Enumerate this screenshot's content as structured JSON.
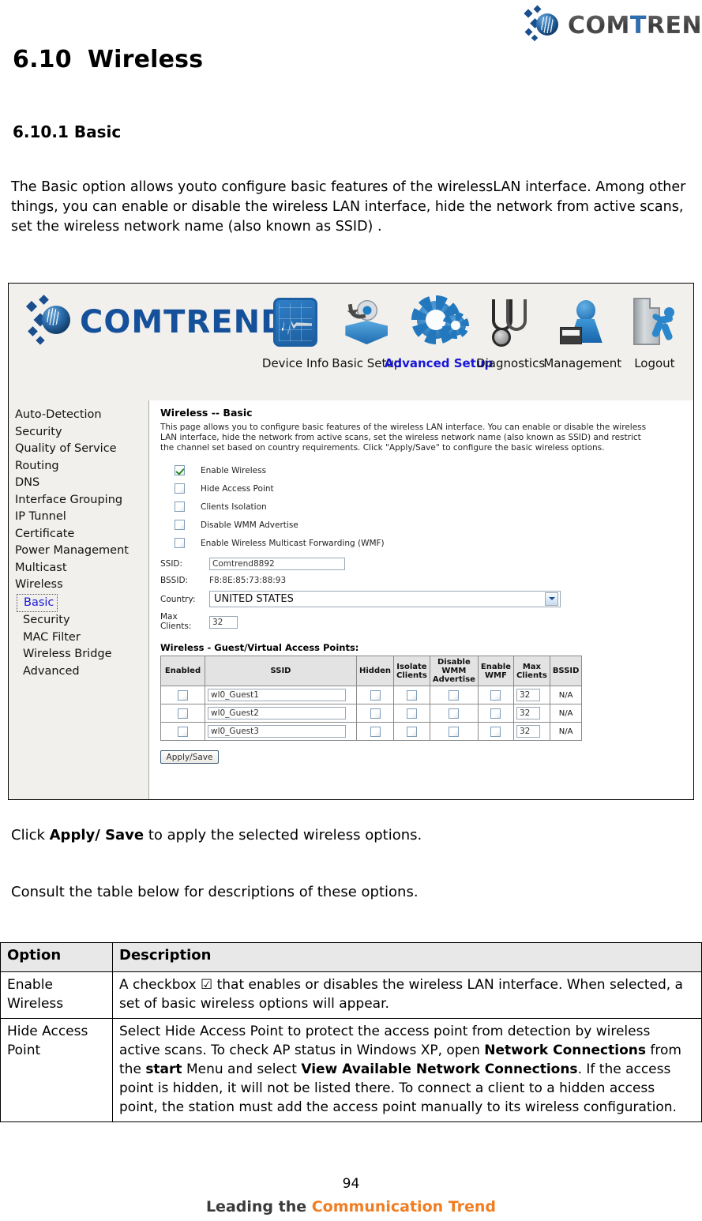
{
  "page": {
    "brand": "COMTREND",
    "brand_t": "T",
    "section_number": "6.10",
    "section_title": "Wireless",
    "subsection_title": "6.10.1 Basic",
    "intro_paragraph": "The Basic option allows youto configure basic features of the wirelessLAN interface. Among other things, you can enable or disable the wireless LAN interface, hide the network from active scans, set the wireless network name (also known as SSID) .",
    "click_apply_prefix": "Click ",
    "click_apply_bold": "Apply/ Save",
    "click_apply_suffix": " to apply the selected wireless options.",
    "consult_paragraph": "Consult the table below for descriptions of these options.",
    "page_number": "94",
    "footer_lead": "Leading the ",
    "footer_orange1": "Communication ",
    "footer_orange2": "Trend"
  },
  "router_ui": {
    "brand": "COMTREND",
    "nav": [
      {
        "label": "Device Info",
        "icon": "device-info-icon",
        "active": false
      },
      {
        "label": "Basic Setup",
        "icon": "basic-setup-icon",
        "active": false
      },
      {
        "label": "Advanced Setup",
        "icon": "advanced-setup-gear-icon",
        "active": true
      },
      {
        "label": "Diagnostics",
        "icon": "stethoscope-icon",
        "active": false
      },
      {
        "label": "Management",
        "icon": "management-user-icon",
        "active": false
      },
      {
        "label": "Logout",
        "icon": "logout-door-icon",
        "active": false
      }
    ],
    "sidebar": [
      {
        "label": "Auto-Detection",
        "sub": false,
        "current": false
      },
      {
        "label": "Security",
        "sub": false,
        "current": false
      },
      {
        "label": "Quality of Service",
        "sub": false,
        "current": false
      },
      {
        "label": "Routing",
        "sub": false,
        "current": false
      },
      {
        "label": "DNS",
        "sub": false,
        "current": false
      },
      {
        "label": "Interface Grouping",
        "sub": false,
        "current": false
      },
      {
        "label": "IP Tunnel",
        "sub": false,
        "current": false
      },
      {
        "label": "Certificate",
        "sub": false,
        "current": false
      },
      {
        "label": "Power Management",
        "sub": false,
        "current": false
      },
      {
        "label": "Multicast",
        "sub": false,
        "current": false
      },
      {
        "label": "Wireless",
        "sub": false,
        "current": false
      },
      {
        "label": "Basic",
        "sub": true,
        "current": true
      },
      {
        "label": "Security",
        "sub": true,
        "current": false
      },
      {
        "label": "MAC Filter",
        "sub": true,
        "current": false
      },
      {
        "label": "Wireless Bridge",
        "sub": true,
        "current": false
      },
      {
        "label": "Advanced",
        "sub": true,
        "current": false
      }
    ],
    "content": {
      "title": "Wireless -- Basic",
      "description": "This page allows you to configure basic features of the wireless LAN interface. You can enable or disable the wireless LAN interface, hide the network from active scans, set the wireless network name (also known as SSID) and restrict the channel set based on country requirements. Click \"Apply/Save\" to configure the basic wireless options.",
      "checkboxes": [
        {
          "label": "Enable Wireless",
          "checked": true
        },
        {
          "label": "Hide Access Point",
          "checked": false
        },
        {
          "label": "Clients Isolation",
          "checked": false
        },
        {
          "label": "Disable WMM Advertise",
          "checked": false
        },
        {
          "label": "Enable Wireless Multicast Forwarding (WMF)",
          "checked": false
        }
      ],
      "fields": {
        "ssid_label": "SSID:",
        "ssid_value": "Comtrend8892",
        "bssid_label": "BSSID:",
        "bssid_value": "F8:8E:85:73:88:93",
        "country_label": "Country:",
        "country_value": "UNITED STATES",
        "max_clients_label_line1": "Max",
        "max_clients_label_line2": "Clients:",
        "max_clients_value": "32"
      },
      "guest_table": {
        "title": "Wireless - Guest/Virtual Access Points:",
        "headers": [
          "Enabled",
          "SSID",
          "Hidden",
          "Isolate Clients",
          "Disable WMM Advertise",
          "Enable WMF",
          "Max Clients",
          "BSSID"
        ],
        "rows": [
          {
            "enabled": false,
            "ssid": "wl0_Guest1",
            "hidden": false,
            "isolate": false,
            "disable_wmm": false,
            "enable_wmf": false,
            "max_clients": "32",
            "bssid": "N/A"
          },
          {
            "enabled": false,
            "ssid": "wl0_Guest2",
            "hidden": false,
            "isolate": false,
            "disable_wmm": false,
            "enable_wmf": false,
            "max_clients": "32",
            "bssid": "N/A"
          },
          {
            "enabled": false,
            "ssid": "wl0_Guest3",
            "hidden": false,
            "isolate": false,
            "disable_wmm": false,
            "enable_wmf": false,
            "max_clients": "32",
            "bssid": "N/A"
          }
        ]
      },
      "apply_button": "Apply/Save"
    }
  },
  "options_table": {
    "header_option": "Option",
    "header_description": "Description",
    "rows": [
      {
        "option": "Enable Wireless",
        "description": "A checkbox ☑ that enables or disables the wireless LAN interface. When selected, a set of basic wireless options will appear."
      },
      {
        "option": "Hide Access Point",
        "description_part1": "Select Hide Access Point to protect the access point from detection by wireless active scans. To check AP status in Windows XP, open ",
        "description_bold1": "Network Connections",
        "description_part2": " from the ",
        "description_bold2": "start",
        "description_part3": " Menu and select ",
        "description_bold3": "View Available Network Connections",
        "description_part4": ". If the access point is hidden, it will not be listed there. To connect a client to a hidden access point, the station must add the access point manually to its wireless configuration."
      }
    ]
  },
  "colors": {
    "accent_blue": "#15509b",
    "active_nav": "#1616d8",
    "ui_chrome_bg": "#f2f0ec",
    "table_header_bg": "#e3e3e3",
    "footer_orange": "#f07d22"
  }
}
